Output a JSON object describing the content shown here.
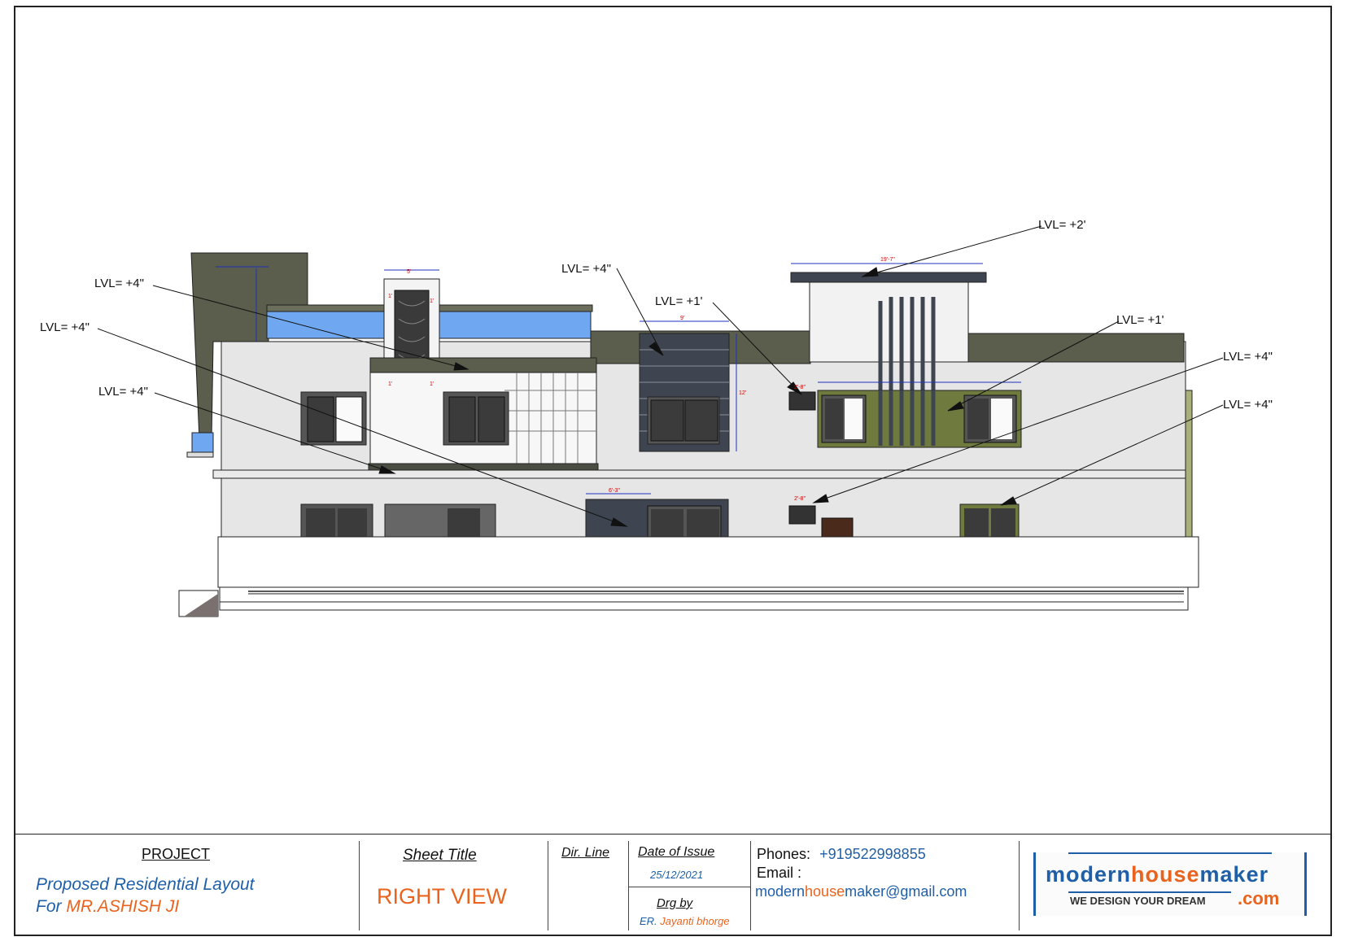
{
  "levels": [
    {
      "text": "LVL= +4\""
    },
    {
      "text": "LVL= +4\""
    },
    {
      "text": "LVL= +4\""
    },
    {
      "text": "LVL= +4\""
    },
    {
      "text": "LVL= +1'"
    },
    {
      "text": "LVL= +2'"
    },
    {
      "text": "LVL= +1'"
    },
    {
      "text": "LVL= +4\""
    },
    {
      "text": "LVL= +4\""
    }
  ],
  "dimensions": {
    "d_5": "5'",
    "d_19_7": "19'-7\"",
    "d_9": "9'",
    "d_12": "12'",
    "d_6_3": "6'-3\"",
    "d_2_8a": "2'-8\"",
    "d_2_8b": "2'-8\"",
    "d_1a": "1'",
    "d_1b": "1'",
    "d_1c": "1'",
    "d_1d": "1'"
  },
  "title_block": {
    "project_heading": "PROJECT",
    "project_line1": "Proposed Residential Layout",
    "project_line2_prefix": "For ",
    "project_line2_name": "MR.ASHISH  JI",
    "sheet_title_heading": "Sheet Title",
    "sheet_title": "RIGHT VIEW",
    "dir_line": "Dir. Line",
    "date_heading": "Date of Issue",
    "date": "25/12/2021",
    "drg_heading": "Drg by",
    "drg_prefix": "ER. ",
    "drg_name": "Jayanti bhorge",
    "phones_label": "Phones:",
    "phone": "+919522998855",
    "email_label": "Email :",
    "email_part1": "modern",
    "email_part2": "house",
    "email_part3": "maker",
    "email_part4": "@gmail",
    "email_part5": ".com"
  },
  "logo": {
    "word1": "modern",
    "word2": "house",
    "word3": "maker",
    "tagline": "WE DESIGN YOUR DREAM",
    "tld": ".com"
  },
  "colors": {
    "blue_text": "#1f5fa8",
    "orange_text": "#e8641e",
    "wall": "#e6e6e6",
    "dark_panel": "#3f4550",
    "olive": "#6f7a3f",
    "roof": "#5b5e4c",
    "glass_blue": "#6fa8f0"
  }
}
